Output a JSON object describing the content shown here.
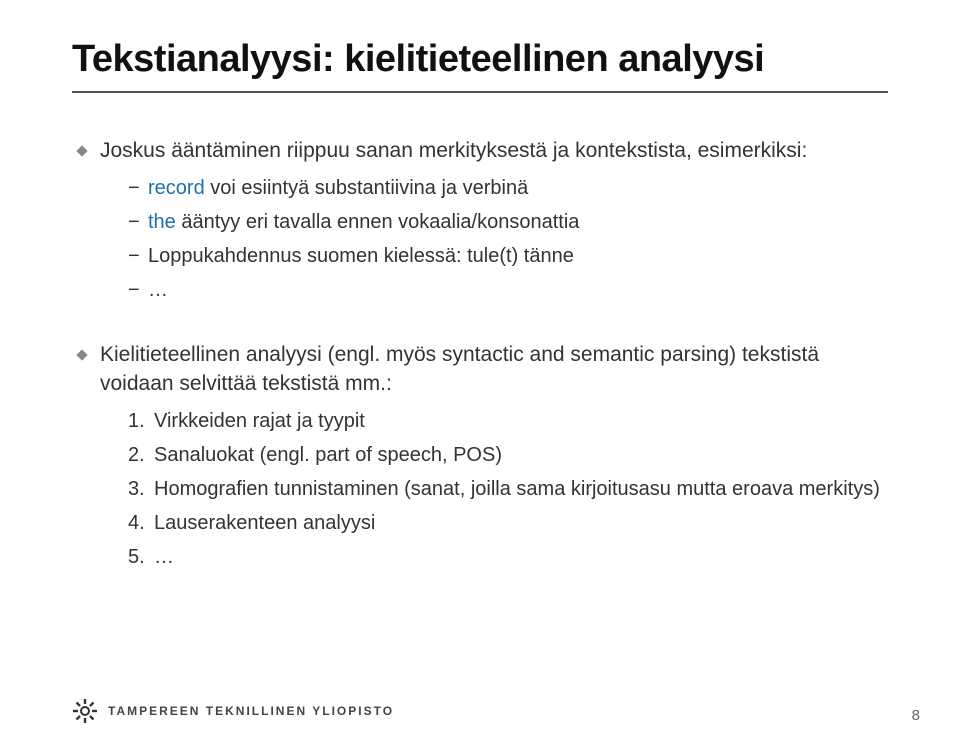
{
  "title": "Tekstianalyysi: kielitieteellinen analyysi",
  "bullet1": "Joskus ääntäminen riippuu sanan merkityksestä ja kontekstista, esimerkiksi:",
  "sub1_a_pre": "record ",
  "sub1_a_post": "voi esiintyä substantiivina ja verbinä",
  "sub1_b_pre": "the ",
  "sub1_b_post": "ääntyy eri tavalla ennen vokaalia/konsonattia",
  "sub1_c": "Loppukahdennus suomen kielessä: tule(t) tänne",
  "sub1_d": "…",
  "bullet2": "Kielitieteellinen analyysi (engl. myös syntactic and semantic parsing) tekstistä voidaan selvittää tekstistä mm.:",
  "ord1": "Virkkeiden rajat ja tyypit",
  "ord2": "Sanaluokat (engl. part of speech, POS)",
  "ord3": "Homografien tunnistaminen (sanat, joilla sama kirjoitusasu mutta eroava merkitys)",
  "ord4": "Lauserakenteen analyysi",
  "ord5": "…",
  "n1": "1.",
  "n2": "2.",
  "n3": "3.",
  "n4": "4.",
  "n5": "5.",
  "footer": "TAMPEREEN TEKNILLINEN YLIOPISTO",
  "page": "8"
}
